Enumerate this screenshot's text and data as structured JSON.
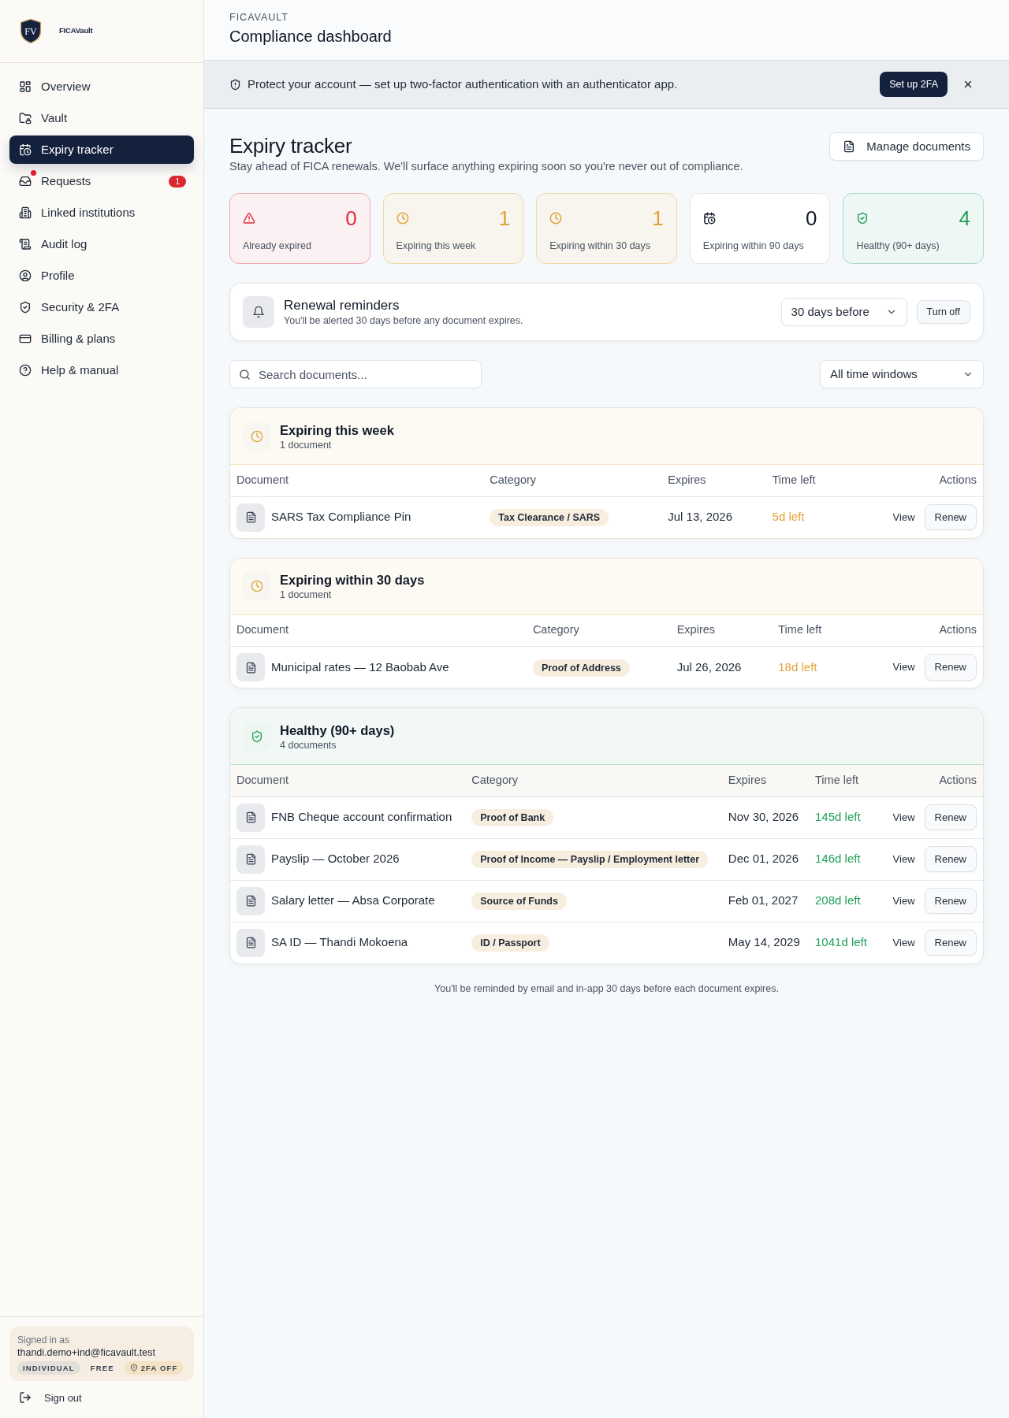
{
  "sidebar": {
    "logo": {
      "monogram": "FV",
      "wordmark": "FICAVault"
    },
    "nav": [
      {
        "label": "Overview",
        "selected": false,
        "notify": false
      },
      {
        "label": "Vault",
        "selected": false,
        "notify": false
      },
      {
        "label": "Expiry tracker",
        "selected": true,
        "notify": false
      },
      {
        "label": "Requests",
        "selected": false,
        "notify": true,
        "badge": "1"
      },
      {
        "label": "Linked institutions",
        "selected": false,
        "notify": false
      },
      {
        "label": "Audit log",
        "selected": false,
        "notify": false
      },
      {
        "label": "Profile",
        "selected": false,
        "notify": false
      },
      {
        "label": "Security & 2FA",
        "selected": false,
        "notify": false
      },
      {
        "label": "Billing & plans",
        "selected": false,
        "notify": false
      },
      {
        "label": "Help & manual",
        "selected": false,
        "notify": false
      }
    ],
    "account": {
      "caption": "Signed in as",
      "email": "thandi.demo+ind@ficavault.test",
      "tags": [
        {
          "label": "INDIVIDUAL",
          "kind": "plan"
        },
        {
          "label": "FREE",
          "kind": "plain"
        },
        {
          "label": "2FA OFF",
          "kind": "alert"
        }
      ]
    },
    "sign_out": "Sign out"
  },
  "header": {
    "eyebrow": "FICAVAULT",
    "title": "Compliance dashboard"
  },
  "banner": {
    "text": "Protect your account — set up two-factor authentication with an authenticator app.",
    "button": "Set up 2FA"
  },
  "page": {
    "title": "Expiry tracker",
    "subtitle": "Stay ahead of FICA renewals. We'll surface anything expiring soon so you're never out of compliance.",
    "button": "Manage documents"
  },
  "stats": [
    {
      "kind": "danger",
      "value": "0",
      "label": "Already expired"
    },
    {
      "kind": "warning",
      "value": "1",
      "label": "Expiring this week"
    },
    {
      "kind": "warning",
      "value": "1",
      "label": "Expiring within 30 days"
    },
    {
      "kind": "neutral",
      "value": "0",
      "label": "Expiring within 90 days"
    },
    {
      "kind": "success",
      "value": "4",
      "label": "Healthy (90+ days)"
    }
  ],
  "reminders": {
    "title": "Renewal reminders",
    "text": "You'll be alerted 30 days before any document expires.",
    "select": "30 days before",
    "button": "Turn off"
  },
  "search": {
    "placeholder": "Search documents..."
  },
  "filter": {
    "value": "All time windows"
  },
  "sections": [
    {
      "kind": "warning",
      "title": "Expiring this week",
      "count": "1 document",
      "columns": [
        "Document",
        "Category",
        "Expires",
        "Time left",
        "Actions"
      ],
      "rows": [
        {
          "document": "SARS Tax Compliance Pin",
          "category": "Tax Clearance / SARS",
          "expires": "Jul 13, 2026",
          "time_left": "5d left",
          "view": "View",
          "renew": "Renew"
        }
      ]
    },
    {
      "kind": "warning",
      "title": "Expiring within 30 days",
      "count": "1 document",
      "columns": [
        "Document",
        "Category",
        "Expires",
        "Time left",
        "Actions"
      ],
      "rows": [
        {
          "document": "Municipal rates — 12 Baobab Ave",
          "category": "Proof of Address",
          "expires": "Jul 26, 2026",
          "time_left": "18d left",
          "view": "View",
          "renew": "Renew"
        }
      ]
    },
    {
      "kind": "success",
      "title": "Healthy (90+ days)",
      "count": "4 documents",
      "columns": [
        "Document",
        "Category",
        "Expires",
        "Time left",
        "Actions"
      ],
      "rows": [
        {
          "document": "FNB Cheque account confirmation",
          "category": "Proof of Bank",
          "expires": "Nov 30, 2026",
          "time_left": "145d left",
          "view": "View",
          "renew": "Renew"
        },
        {
          "document": "Payslip — October 2026",
          "category": "Proof of Income — Payslip / Employment letter",
          "expires": "Dec 01, 2026",
          "time_left": "146d left",
          "view": "View",
          "renew": "Renew"
        },
        {
          "document": "Salary letter — Absa Corporate",
          "category": "Source of Funds",
          "expires": "Feb 01, 2027",
          "time_left": "208d left",
          "view": "View",
          "renew": "Renew"
        },
        {
          "document": "SA ID — Thandi Mokoena",
          "category": "ID / Passport",
          "expires": "May 14, 2029",
          "time_left": "1041d left",
          "view": "View",
          "renew": "Renew"
        }
      ]
    }
  ],
  "footer_note": "You'll be reminded by email and in-app 30 days before each document expires."
}
